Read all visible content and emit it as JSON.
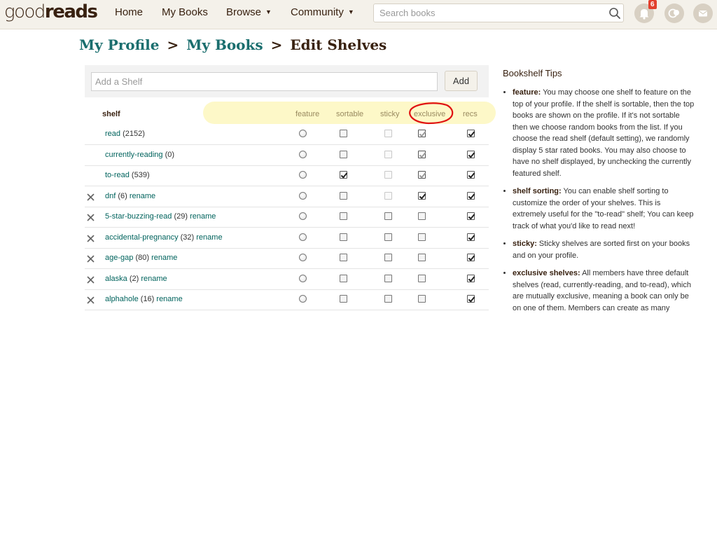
{
  "topbar": {
    "logo_left": "good",
    "logo_right": "reads",
    "nav": [
      {
        "label": "Home"
      },
      {
        "label": "My Books"
      },
      {
        "label": "Browse",
        "caret": "▼"
      },
      {
        "label": "Community",
        "caret": "▼"
      }
    ],
    "search_placeholder": "Search books",
    "notifications_count": "6",
    "icons": [
      "search-icon",
      "notifications-icon",
      "friends-icon",
      "messages-icon"
    ]
  },
  "breadcrumb": {
    "profile": "My Profile",
    "sep1": ">",
    "mybooks": "My Books",
    "sep2": ">",
    "current": "Edit Shelves"
  },
  "add_shelf": {
    "placeholder": "Add a Shelf",
    "button": "Add"
  },
  "table": {
    "headers": {
      "shelf": "shelf",
      "feature": "feature",
      "sortable": "sortable",
      "sticky": "sticky",
      "exclusive": "exclusive",
      "recs": "recs"
    },
    "rows": [
      {
        "name": "read",
        "count": "(2152)",
        "rename": "",
        "deletable": false,
        "sortable": "off",
        "sticky": "disabled-off",
        "exclusive": "disabled-on",
        "recs": "on"
      },
      {
        "name": "currently-reading",
        "count": "(0)",
        "rename": "",
        "deletable": false,
        "sortable": "off",
        "sticky": "disabled-off",
        "exclusive": "disabled-on",
        "recs": "on"
      },
      {
        "name": "to-read",
        "count": "(539)",
        "rename": "",
        "deletable": false,
        "sortable": "on",
        "sticky": "disabled-off",
        "exclusive": "disabled-on",
        "recs": "on"
      },
      {
        "name": "dnf",
        "count": "(6)",
        "rename": "rename",
        "deletable": true,
        "sortable": "off",
        "sticky": "disabled-off",
        "exclusive": "on",
        "recs": "on"
      },
      {
        "name": "5-star-buzzing-read",
        "count": "(29)",
        "rename": "rename",
        "deletable": true,
        "sortable": "off",
        "sticky": "off",
        "exclusive": "off",
        "recs": "on"
      },
      {
        "name": "accidental-pregnancy",
        "count": "(32)",
        "rename": "rename",
        "deletable": true,
        "sortable": "off",
        "sticky": "off",
        "exclusive": "off",
        "recs": "on"
      },
      {
        "name": "age-gap",
        "count": "(80)",
        "rename": "rename",
        "deletable": true,
        "sortable": "off",
        "sticky": "off",
        "exclusive": "off",
        "recs": "on"
      },
      {
        "name": "alaska",
        "count": "(2)",
        "rename": "rename",
        "deletable": true,
        "sortable": "off",
        "sticky": "off",
        "exclusive": "off",
        "recs": "on"
      },
      {
        "name": "alphahole",
        "count": "(16)",
        "rename": "rename",
        "deletable": true,
        "sortable": "off",
        "sticky": "off",
        "exclusive": "off",
        "recs": "on"
      }
    ]
  },
  "tips": {
    "title": "Bookshelf Tips",
    "items": [
      {
        "label": "feature:",
        "text": "You may choose one shelf to feature on the top of your profile. If the shelf is sortable, then the top books are shown on the profile. If it's not sortable then we choose random books from the list. If you choose the read shelf (default setting), we randomly display 5 star rated books. You may also choose to have no shelf displayed, by unchecking the currently featured shelf."
      },
      {
        "label": "shelf sorting:",
        "text": "You can enable shelf sorting to customize the order of your shelves. This is extremely useful for the \"to-read\" shelf; You can keep track of what you'd like to read next!"
      },
      {
        "label": "sticky:",
        "text": "Sticky shelves are sorted first on your books and on your profile."
      },
      {
        "label": "exclusive shelves:",
        "text": "All members have three default shelves (read, currently-reading, and to-read), which are mutually exclusive, meaning a book can only be on one of them. Members can create as many"
      }
    ]
  }
}
